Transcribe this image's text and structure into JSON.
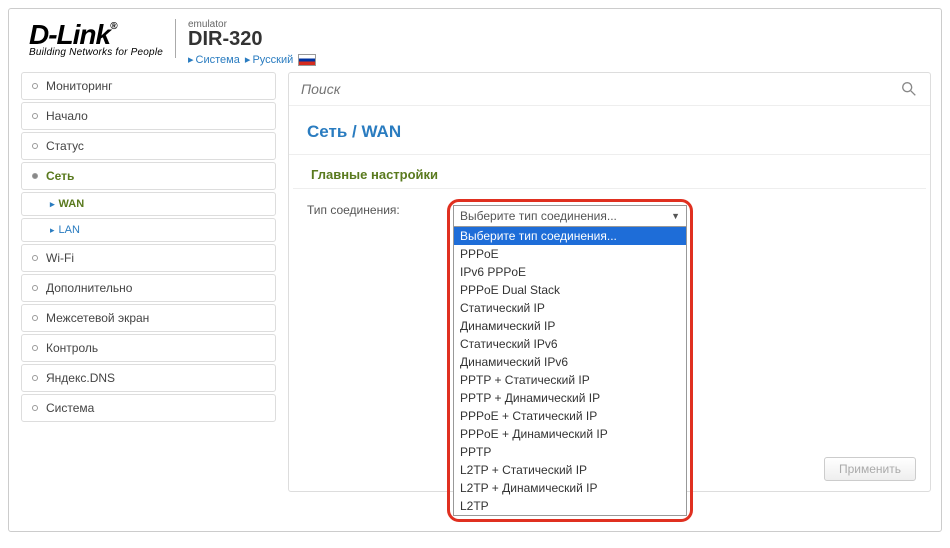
{
  "header": {
    "logo_text": "D-Link",
    "logo_tagline": "Building Networks for People",
    "emulator_tag": "emulator",
    "model": "DIR-320",
    "lang_crumbs": [
      "Система",
      "Русский"
    ]
  },
  "sidebar": {
    "items": [
      {
        "label": "Мониторинг",
        "active": false
      },
      {
        "label": "Начало",
        "active": false
      },
      {
        "label": "Статус",
        "active": false
      },
      {
        "label": "Сеть",
        "active": true,
        "children": [
          {
            "label": "WAN",
            "selected": true
          },
          {
            "label": "LAN",
            "selected": false
          }
        ]
      },
      {
        "label": "Wi-Fi",
        "active": false
      },
      {
        "label": "Дополнительно",
        "active": false
      },
      {
        "label": "Межсетевой экран",
        "active": false
      },
      {
        "label": "Контроль",
        "active": false
      },
      {
        "label": "Яндекс.DNS",
        "active": false
      },
      {
        "label": "Система",
        "active": false
      }
    ]
  },
  "main": {
    "search_placeholder": "Поиск",
    "breadcrumb": "Сеть /  WAN",
    "section_title": "Главные настройки",
    "field_label": "Тип соединения:",
    "dropdown": {
      "selected": "Выберите тип соединения...",
      "options": [
        "Выберите тип соединения...",
        "PPPoE",
        "IPv6 PPPoE",
        "PPPoE Dual Stack",
        "Статический IP",
        "Динамический IP",
        "Статический IPv6",
        "Динамический IPv6",
        "PPTP + Статический IP",
        "PPTP + Динамический IP",
        "PPPoE + Статический IP",
        "PPPoE + Динамический IP",
        "PPTP",
        "L2TP + Статический IP",
        "L2TP + Динамический IP",
        "L2TP"
      ]
    },
    "apply_label": "Применить"
  }
}
